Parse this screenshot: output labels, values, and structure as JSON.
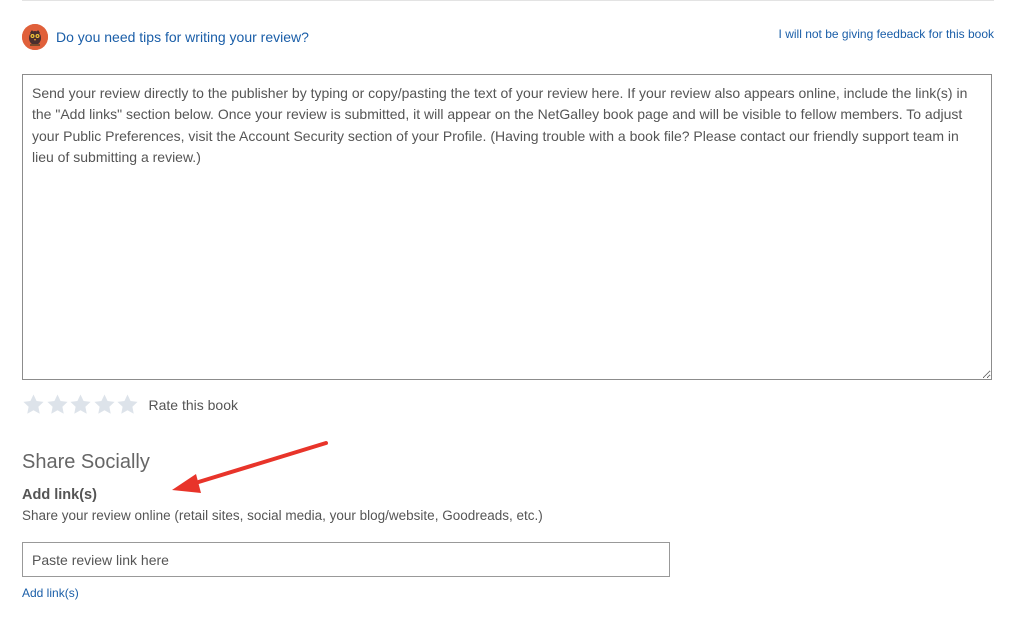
{
  "tips": {
    "link_text": "Do you need tips for writing your review?"
  },
  "feedback": {
    "decline_link": "I will not be giving feedback for this book"
  },
  "review": {
    "placeholder": "Send your review directly to the publisher by typing or copy/pasting the text of your review here. If your review also appears online, include the link(s) in the \"Add links\" section below. Once your review is submitted, it will appear on the NetGalley book page and will be visible to fellow members. To adjust your Public Preferences, visit the Account Security section of your Profile. (Having trouble with a book file? Please contact our friendly support team in lieu of submitting a review.)",
    "value": ""
  },
  "rating": {
    "label": "Rate this book",
    "max_stars": 5,
    "current": 0,
    "star_color": "#dde3ea"
  },
  "share": {
    "heading": "Share Socially",
    "add_links_title": "Add link(s)",
    "add_links_description": "Share your review online (retail sites, social media, your blog/website, Goodreads, etc.)",
    "link_placeholder": "Paste review link here",
    "add_links_button": "Add link(s)"
  },
  "colors": {
    "link": "#1a5ea8",
    "annotation_arrow": "#e8342a",
    "owl_badge": "#e0603a"
  }
}
